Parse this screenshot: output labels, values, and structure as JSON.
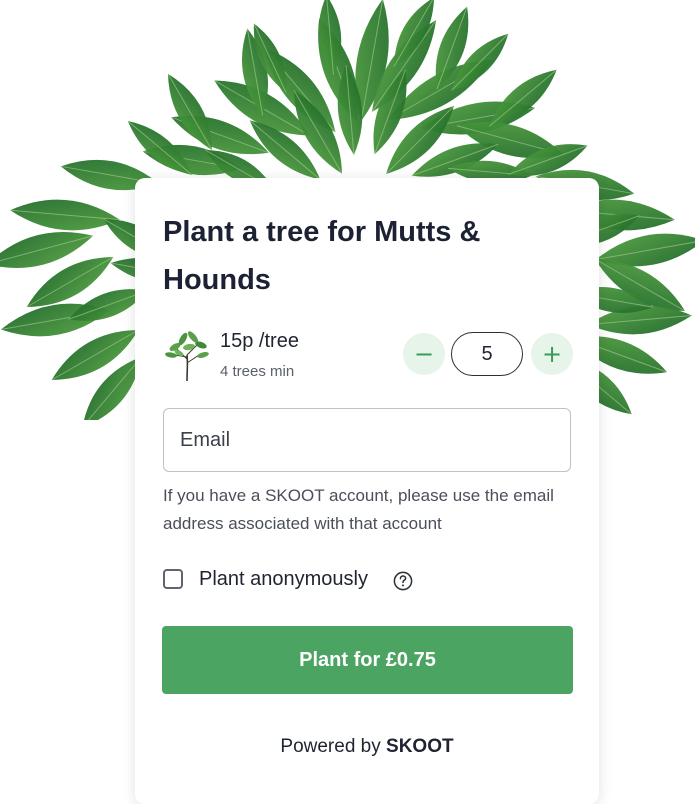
{
  "widget": {
    "title": "Plant a tree for Mutts & Hounds",
    "price_label": "15p /tree",
    "min_label": "4 trees min",
    "quantity": "5",
    "minus_symbol": "−",
    "plus_symbol": "+",
    "email_placeholder": "Email",
    "email_hint": "If you have a SKOOT account, please use the email address associated with that account",
    "anonymous_label": "Plant anonymously",
    "anonymous_checked": false,
    "cta_label": "Plant for £0.75",
    "powered_prefix": "Powered by",
    "powered_brand": "SKOOT"
  },
  "icons": {
    "tree": "tree-icon",
    "help": "help-icon",
    "decoration": "leaves-foliage"
  },
  "colors": {
    "accent": "#4ca462",
    "stepper_bg": "#e6f4ea",
    "leaf": "#2f7d34"
  }
}
